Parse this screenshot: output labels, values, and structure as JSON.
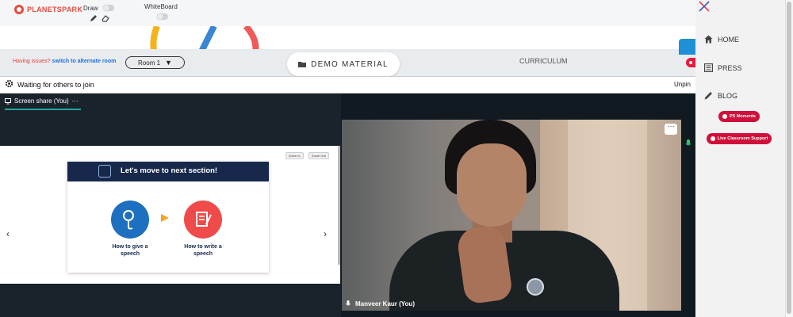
{
  "toolbar": {
    "logo_text": "PLANETSPARK",
    "draw_label": "Draw",
    "whiteboard_label": "WhiteBoard"
  },
  "roombar": {
    "issues_text": "Having issues?",
    "alt_link": "switch to alternate room",
    "room_value": "Room 1",
    "demo_tab": "DEMO MATERIAL",
    "curriculum_tab": "CURRICULUM"
  },
  "meeting": {
    "waiting_text": "Waiting for others to join",
    "unpin_label": "Unpin",
    "screen_share_tab": "Screen share (You)",
    "screen_share_more": "···",
    "zoom_in_label": "Zoom In",
    "zoom_out_label": "Zoom Out",
    "slide_title": "Let's move to next section!",
    "step_one": "How to give a speech",
    "step_two": "How to write a speech",
    "participant_name": "Manveer Kaur (You)"
  },
  "sidebar": {
    "items": [
      {
        "label": "HOME",
        "icon": "home-icon"
      },
      {
        "label": "PRESS",
        "icon": "newspaper-icon"
      },
      {
        "label": "BLOG",
        "icon": "pencil-icon"
      }
    ],
    "ps_moments": "PS Moments",
    "live_support": "Live Classroom Support"
  },
  "colors": {
    "brand_red": "#e84a3c",
    "accent_blue": "#1f8fd6",
    "pill_red": "#d0103a",
    "slide_navy": "#17284b",
    "teal_underline": "#26a69a"
  }
}
